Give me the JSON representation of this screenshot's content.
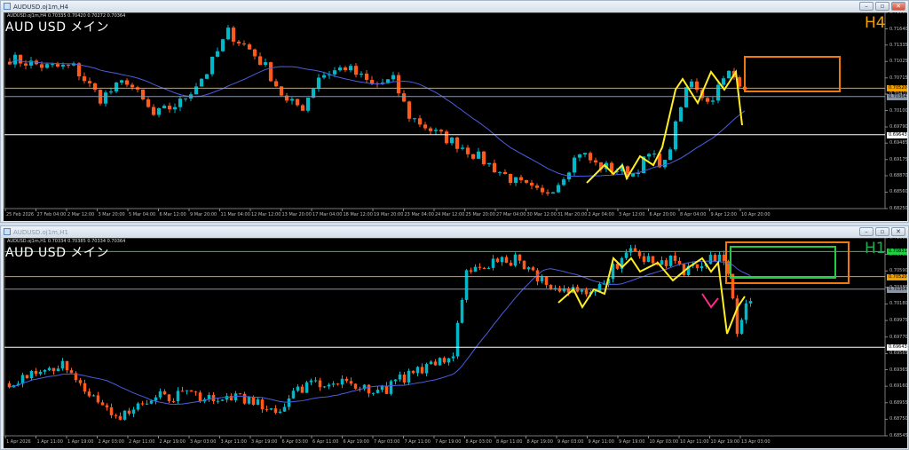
{
  "windows": [
    {
      "title": "AUDUSD.oj1m,H4",
      "info": "AUDUSD.oj1m,H4  0.70335 0.70420 0.70272 0.70364",
      "symbol_label": "AUD USD  メイン",
      "timeframe_label": "H4",
      "timeframe_color": "#f0a000"
    },
    {
      "title": "AUDUSD.oj1m,H1",
      "info": "AUDUSD.oj1m,H1  0.70334 0.70385 0.70334 0.70364",
      "symbol_label": "AUD USD  メイン",
      "timeframe_label": "H1",
      "timeframe_color": "#22aa55"
    }
  ],
  "colors": {
    "bull": "#00b8c8",
    "bear": "#ff5a1e",
    "ma": "#4a5ee0",
    "zigzag": "#ffee22",
    "box_orange": "#f07810",
    "box_green": "#22cc44",
    "pink": "#ff2a8a"
  },
  "chart_data": [
    {
      "type": "candlestick",
      "symbol": "AUDUSD.oj1m",
      "timeframe": "H4",
      "ylim": [
        0.6825,
        0.7195
      ],
      "price_ticks": [
        "0.71950",
        "0.71640",
        "0.71335",
        "0.71025",
        "0.70715",
        "0.70410",
        "0.70100",
        "0.69790",
        "0.69485",
        "0.69175",
        "0.68870",
        "0.68560",
        "0.68250"
      ],
      "time_ticks": [
        "25 Feb 2026",
        "27 Feb 04:00",
        "2 Mar 12:00",
        "3 Mar 20:00",
        "5 Mar 04:00",
        "6 Mar 12:00",
        "9 Mar 20:00",
        "11 Mar 04:00",
        "12 Mar 12:00",
        "13 Mar 20:00",
        "17 Mar 04:00",
        "18 Mar 12:00",
        "19 Mar 20:00",
        "23 Mar 04:00",
        "24 Mar 12:00",
        "25 Mar 20:00",
        "27 Mar 04:00",
        "30 Mar 12:00",
        "31 Mar 20:00",
        "2 Apr 04:00",
        "3 Apr 12:00",
        "6 Apr 20:00",
        "8 Apr 04:00",
        "9 Apr 12:00",
        "10 Apr 20:00"
      ],
      "candle_count": 139,
      "approx_close_path": [
        [
          0,
          0.7108
        ],
        [
          7,
          0.7092
        ],
        [
          12,
          0.7092
        ],
        [
          17,
          0.7033
        ],
        [
          22,
          0.7067
        ],
        [
          27,
          0.7
        ],
        [
          32,
          0.7025
        ],
        [
          37,
          0.7083
        ],
        [
          41,
          0.7158
        ],
        [
          45,
          0.7125
        ],
        [
          48,
          0.7092
        ],
        [
          52,
          0.7025
        ],
        [
          55,
          0.7017
        ],
        [
          58,
          0.7075
        ],
        [
          63,
          0.7092
        ],
        [
          68,
          0.7058
        ],
        [
          72,
          0.7067
        ],
        [
          75,
          0.7
        ],
        [
          80,
          0.6967
        ],
        [
          85,
          0.6942
        ],
        [
          90,
          0.6908
        ],
        [
          95,
          0.6875
        ],
        [
          100,
          0.685
        ],
        [
          103,
          0.6875
        ],
        [
          107,
          0.6933
        ],
        [
          110,
          0.6908
        ],
        [
          113,
          0.69
        ],
        [
          117,
          0.6892
        ],
        [
          120,
          0.6925
        ],
        [
          123,
          0.6908
        ],
        [
          127,
          0.705
        ],
        [
          128,
          0.707
        ],
        [
          131,
          0.7025
        ],
        [
          135,
          0.708
        ],
        [
          138,
          0.7058
        ],
        [
          139,
          0.6983
        ]
      ],
      "hlines": [
        {
          "price": 0.7052,
          "label": "0.70520",
          "color": "#f0a000"
        },
        {
          "price": 0.70364,
          "label": "0.70364",
          "color": "#8a96a6"
        },
        {
          "price": 0.69643,
          "label": "0.69643",
          "color": "#ffffff"
        }
      ],
      "ma_period": 20
    },
    {
      "type": "candlestick",
      "symbol": "AUDUSD.oj1m",
      "timeframe": "H1",
      "ylim": [
        0.68545,
        0.71
      ],
      "price_ticks": [
        "0.71000",
        "0.70795",
        "0.70590",
        "0.70385",
        "0.70180",
        "0.69975",
        "0.69770",
        "0.69565",
        "0.69365",
        "0.69160",
        "0.68955",
        "0.68750",
        "0.68545"
      ],
      "time_ticks": [
        "1 Apr 2026",
        "1 Apr 11:00",
        "1 Apr 19:00",
        "2 Apr 03:00",
        "2 Apr 11:00",
        "2 Apr 19:00",
        "3 Apr 03:00",
        "3 Apr 11:00",
        "3 Apr 19:00",
        "6 Apr 03:00",
        "6 Apr 11:00",
        "6 Apr 19:00",
        "7 Apr 03:00",
        "7 Apr 11:00",
        "7 Apr 19:00",
        "8 Apr 03:00",
        "8 Apr 11:00",
        "8 Apr 19:00",
        "9 Apr 03:00",
        "9 Apr 11:00",
        "9 Apr 19:00",
        "10 Apr 03:00",
        "10 Apr 11:00",
        "10 Apr 19:00",
        "13 Apr 03:00"
      ],
      "candle_count": 168,
      "approx_close_path": [
        [
          0,
          0.6922
        ],
        [
          6,
          0.6933
        ],
        [
          12,
          0.6945
        ],
        [
          18,
          0.691
        ],
        [
          24,
          0.6875
        ],
        [
          32,
          0.6904
        ],
        [
          40,
          0.6904
        ],
        [
          50,
          0.6904
        ],
        [
          60,
          0.6887
        ],
        [
          68,
          0.6922
        ],
        [
          76,
          0.6922
        ],
        [
          84,
          0.691
        ],
        [
          91,
          0.6933
        ],
        [
          96,
          0.6945
        ],
        [
          100,
          0.6956
        ],
        [
          103,
          0.7061
        ],
        [
          108,
          0.7066
        ],
        [
          114,
          0.7072
        ],
        [
          120,
          0.7049
        ],
        [
          126,
          0.7032
        ],
        [
          132,
          0.7038
        ],
        [
          138,
          0.7072
        ],
        [
          140,
          0.7084
        ],
        [
          144,
          0.7072
        ],
        [
          149,
          0.7072
        ],
        [
          152,
          0.7061
        ],
        [
          156,
          0.7072
        ],
        [
          160,
          0.7072
        ],
        [
          162,
          0.7061
        ],
        [
          164,
          0.6985
        ],
        [
          166,
          0.702
        ],
        [
          168,
          0.7034
        ]
      ],
      "hlines": [
        {
          "price": 0.70831,
          "label": "0.70831",
          "color": "#22cc44"
        },
        {
          "price": 0.7052,
          "label": "0.70520",
          "color": "#f0a000"
        },
        {
          "price": 0.70364,
          "label": "0.70364",
          "color": "#8a96a6"
        },
        {
          "price": 0.69643,
          "label": "0.69643",
          "color": "#ffffff"
        }
      ],
      "ma_period": 20
    }
  ]
}
